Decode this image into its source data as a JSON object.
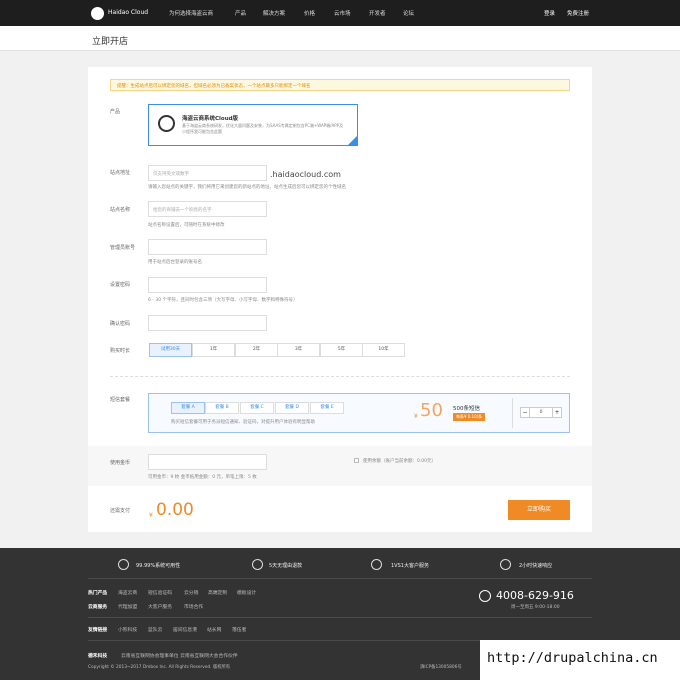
{
  "header": {
    "logo_text": "Haidao Cloud",
    "nav": [
      "为何选择海盗云商",
      "产品",
      "解决方案",
      "价格",
      "云市场",
      "开发者",
      "论坛"
    ],
    "login": "登录",
    "register": "免费注册"
  },
  "page": {
    "title": "立即开店"
  },
  "notice": "提醒：生成站点后可以绑定您的域名，但域名必须为已备案状态，一个站点最多只能绑定一个域名",
  "form": {
    "product_label": "产品",
    "product_card": {
      "title": "海盗云商系统Cloud版",
      "description": "基于海盗云商系统研发，优化大量问题及安装，为SAAS专属定制包含PC端+WAP端/APP及小程序我可能包含此题"
    },
    "site_label": "站点地址",
    "site_placeholder": "仅支持英文或数字",
    "site_suffix": ".haidaocloud.com",
    "site_hint": "请输入您站点的关键字，我们将用它来创建您的新站点的地址，站点生成后您可以绑定您的个性域名",
    "name_label": "站点名称",
    "name_placeholder": "给您的商铺去一个响亮的名字",
    "name_hint": "站点名称设置后，可随时在系统中修改",
    "admin_label": "管理员账号",
    "admin_hint": "用于站点后台登录的账号名",
    "password_label": "设置密码",
    "password_hint": "6 - 30 个字符，且同时包含三项（大写字母、小写字母、数字和特殊符号）",
    "confirm_label": "确认密码",
    "duration_label": "购买时长",
    "durations": [
      "试用30天",
      "1年",
      "2年",
      "3年",
      "5年",
      "10年"
    ],
    "sms_label": "短信套餐",
    "sms_packages": [
      "套餐 A",
      "套餐 B",
      "套餐 C",
      "套餐 D",
      "套餐 E"
    ],
    "sms_hint": "购买短信套餐可用于务派短信通知、验证码，对提升用户体验有明显帮助",
    "sms_price_symbol": "¥",
    "sms_price": "50",
    "sms_count": "500条短信",
    "sms_unit_price": "每条¥ 0.10/条",
    "sms_qty": "0",
    "coin_label": "使用金币",
    "coin_hint": "可用金币：9 枚   金币抵用金额：0 元，单笔上限：5 枚",
    "balance_label": "使用余额（账户当前余额：0.00元）",
    "total_label": "还需支付",
    "total_symbol": "¥",
    "total_value": "0.00",
    "buy_button": "立即购买"
  },
  "footer": {
    "features": [
      "99.99%系统可用性",
      "5天无理由退款",
      "1VS1大客户服务",
      "2小时快速响应"
    ],
    "row1_title": "热门产品",
    "row1_links": [
      "海盗云商",
      "短信验证码",
      "云分销",
      "高端定制",
      "模板设计"
    ],
    "row2_title": "云商服务",
    "row2_links": [
      "代理加盟",
      "大客户服务",
      "市场合作"
    ],
    "row3_title": "友情链接",
    "row3_links": [
      "小熊科技",
      "蓝队云",
      "居间信息港",
      "站长网",
      "落伍者"
    ],
    "phone": "4008-629-916",
    "hours": "周一至周五 9:00-18:00",
    "brand": "德禾科技",
    "units": "云南省互联网协会理事单位  云南省互联网大会合作伙伴",
    "copyright": "Copyright © 2013~2017 Dmbox Inc. All Rights Reserved. 版权所有",
    "icp": "滇ICP备13005806号"
  },
  "watermark": "http://drupalchina.cn"
}
